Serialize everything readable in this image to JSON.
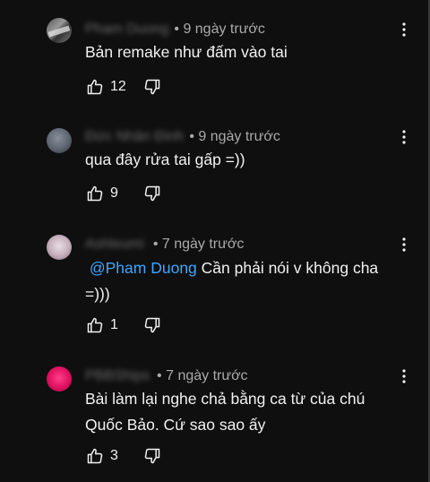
{
  "comments": [
    {
      "author": "Pham Duong",
      "time": "• 9 ngày trước",
      "text": "Bản remake như đấm vào tai",
      "likes": "12"
    },
    {
      "author": "Đức Nhân Đinh",
      "time": "• 9 ngày trước",
      "text": "qua đây rửa tai gấp =))",
      "likes": "9"
    },
    {
      "author": "Ashleumi",
      "time": "• 7 ngày trước",
      "mention": "@Pham Duong",
      "text": " Cần phải nói v không cha =)))",
      "likes": "1"
    },
    {
      "author": "PBBShips",
      "time": "• 7 ngày trước",
      "text": "Bài làm lại nghe chả bằng ca từ của chú Quốc Bảo. Cứ sao sao ấy",
      "likes": "3"
    }
  ],
  "icons": {
    "like": "thumb-up-icon",
    "dislike": "thumb-down-icon",
    "menu": "more-vertical-icon"
  },
  "colors": {
    "background": "#0f0f0f",
    "text": "#f1f1f1",
    "meta": "#aaaaaa",
    "mention": "#3ea6ff"
  }
}
